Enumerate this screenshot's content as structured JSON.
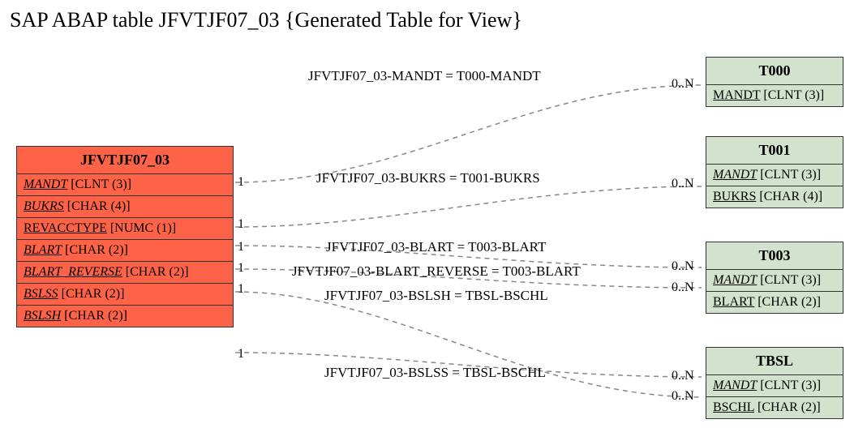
{
  "title": "SAP ABAP table JFVTJF07_03 {Generated Table for View}",
  "main_entity": {
    "name": "JFVTJF07_03",
    "fields": [
      {
        "name": "MANDT",
        "type": "[CLNT (3)]",
        "key": true
      },
      {
        "name": "BUKRS",
        "type": "[CHAR (4)]",
        "key": true
      },
      {
        "name": "REVACCTYPE",
        "type": "[NUMC (1)]",
        "key": false,
        "underline": true
      },
      {
        "name": "BLART",
        "type": "[CHAR (2)]",
        "key": true
      },
      {
        "name": "BLART_REVERSE",
        "type": "[CHAR (2)]",
        "key": true
      },
      {
        "name": "BSLSS",
        "type": "[CHAR (2)]",
        "key": true
      },
      {
        "name": "BSLSH",
        "type": "[CHAR (2)]",
        "key": true
      }
    ]
  },
  "ref_entities": [
    {
      "name": "T000",
      "fields": [
        {
          "name": "MANDT",
          "type": "[CLNT (3)]",
          "underline": true
        }
      ]
    },
    {
      "name": "T001",
      "fields": [
        {
          "name": "MANDT",
          "type": "[CLNT (3)]",
          "key": true
        },
        {
          "name": "BUKRS",
          "type": "[CHAR (4)]",
          "underline": true
        }
      ]
    },
    {
      "name": "T003",
      "fields": [
        {
          "name": "MANDT",
          "type": "[CLNT (3)]",
          "key": true
        },
        {
          "name": "BLART",
          "type": "[CHAR (2)]",
          "underline": true
        }
      ]
    },
    {
      "name": "TBSL",
      "fields": [
        {
          "name": "MANDT",
          "type": "[CLNT (3)]",
          "key": true
        },
        {
          "name": "BSCHL",
          "type": "[CHAR (2)]",
          "underline": true
        }
      ]
    }
  ],
  "relations": [
    {
      "label": "JFVTJF07_03-MANDT = T000-MANDT",
      "card_left": "1",
      "card_right": "0..N"
    },
    {
      "label": "JFVTJF07_03-BUKRS = T001-BUKRS",
      "card_left": "1",
      "card_right": "0..N"
    },
    {
      "label": "JFVTJF07_03-BLART = T003-BLART",
      "card_left": "1",
      "card_right": "0..N"
    },
    {
      "label": "JFVTJF07_03-BLART_REVERSE = T003-BLART",
      "card_left": "1",
      "card_right": "0..N"
    },
    {
      "label": "JFVTJF07_03-BSLSH = TBSL-BSCHL",
      "card_left": "1",
      "card_right": "0..N"
    },
    {
      "label": "JFVTJF07_03-BSLSS = TBSL-BSCHL",
      "card_left": "1",
      "card_right": "0..N"
    }
  ]
}
